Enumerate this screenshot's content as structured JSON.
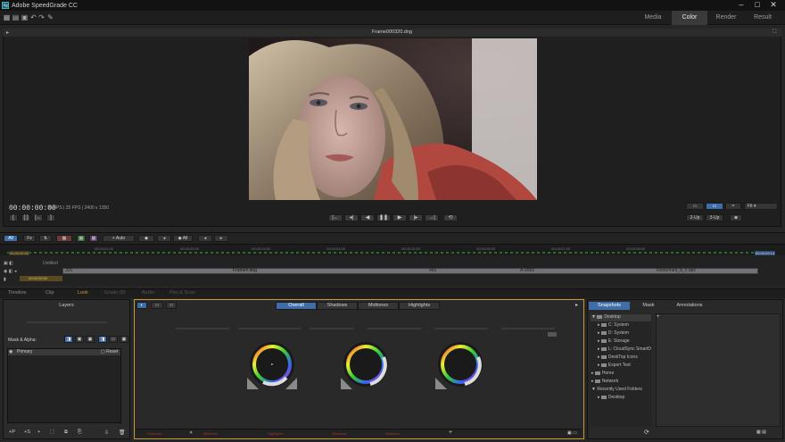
{
  "app": {
    "title": "Adobe SpeedGrade CC",
    "icon_label": "Sg"
  },
  "window": {
    "minimize": "–",
    "maximize": "□",
    "close": "✕"
  },
  "modes": [
    {
      "label": "Media"
    },
    {
      "label": "Color"
    },
    {
      "label": "Render"
    },
    {
      "label": "Result"
    }
  ],
  "viewer": {
    "filename": "Frame000320.dng",
    "timecode": "00:00:00:00",
    "fps1": "25 FPS",
    "fps2": "25 FPS",
    "resolution": "2400 x 1350",
    "fit_value": "Fit",
    "view_2up": "2-Up",
    "view_3up": "3-Up"
  },
  "timeline": {
    "all_label": "All",
    "auto_label": "+ Auto",
    "all2_label": "All",
    "timecode_in": "00:00:00:00",
    "timecode_end": "00:00:09:14",
    "track_name": "Untitled",
    "clip_start": "320",
    "clip_name": "Frame#.dng",
    "clip_end": "460",
    "clip_b": "A-9960",
    "clip_c": "Redarmed_b_#.dpx",
    "ticks": [
      "00:00:01:00",
      "00:00:02:00",
      "00:00:03:00",
      "00:00:04:00",
      "00:00:05:00",
      "00:00:06:00",
      "00:00:07:00",
      "00:00:08:00"
    ]
  },
  "bottom_tabs": [
    {
      "label": "Timeline"
    },
    {
      "label": "Clip"
    },
    {
      "label": "Look"
    },
    {
      "label": "Grade (8)"
    },
    {
      "label": "Audio"
    },
    {
      "label": "Pan & Scan"
    }
  ],
  "layers": {
    "header": "Layers",
    "mask_alpha": "Mask & Alpha:",
    "primary": "Primary",
    "reset": "Reset",
    "footer": [
      "+P",
      "+S",
      "+",
      "⬚",
      "⧉",
      "⎘"
    ]
  },
  "grade": {
    "tabs": [
      "Overall",
      "Shadows",
      "Midtones",
      "Highlights"
    ],
    "presets": [
      "Shadows",
      "Midtones",
      "Highlights",
      "Shadows",
      "Midtones"
    ]
  },
  "right_panel": {
    "tabs": [
      "Snapshots",
      "Mask",
      "Annotations"
    ],
    "tree": [
      {
        "label": "Desktop",
        "indent": 0,
        "arrow": "▼"
      },
      {
        "label": "C: System",
        "indent": 1,
        "arrow": "▸"
      },
      {
        "label": "D: System",
        "indent": 1,
        "arrow": "▸"
      },
      {
        "label": "E: Storage",
        "indent": 1,
        "arrow": "▸"
      },
      {
        "label": "L: CloudSync SmartD",
        "indent": 1,
        "arrow": "▸"
      },
      {
        "label": "DeskTop Icons",
        "indent": 1,
        "arrow": "▸"
      },
      {
        "label": "Export Test",
        "indent": 1,
        "arrow": "▸"
      },
      {
        "label": "Home",
        "indent": 0,
        "arrow": "▸"
      },
      {
        "label": "Network",
        "indent": 0,
        "arrow": "▸"
      },
      {
        "label": "Recently Used Folders",
        "indent": 0,
        "arrow": "▼"
      },
      {
        "label": "Desktop",
        "indent": 1,
        "arrow": "▸"
      }
    ]
  },
  "colors": {
    "accent": "#3e6da8",
    "look_border": "#c49a36"
  }
}
